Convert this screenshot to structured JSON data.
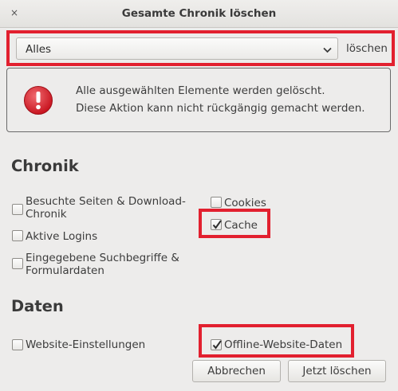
{
  "window": {
    "title": "Gesamte Chronik löschen",
    "close_glyph": "×"
  },
  "range": {
    "selected": "Alles",
    "suffix_label": "löschen"
  },
  "warning": {
    "icon": "warning-icon",
    "line1": "Alle ausgewählten Elemente werden gelöscht.",
    "line2": "Diese Aktion kann nicht rückgängig gemacht werden."
  },
  "sections": {
    "history_title": "Chronik",
    "data_title": "Daten"
  },
  "history_items": {
    "visited_line1": "Besuchte Seiten & Download-",
    "visited_line2": "Chronik",
    "visited_checked": false,
    "logins": "Aktive Logins",
    "logins_checked": false,
    "search_line1": "Eingegebene Suchbegriffe &",
    "search_line2": "Formulardaten",
    "search_checked": false,
    "cookies": "Cookies",
    "cookies_checked": false,
    "cache": "Cache",
    "cache_checked": true
  },
  "data_items": {
    "site_settings": "Website-Einstellungen",
    "site_settings_checked": false,
    "offline_data": "Offline-Website-Daten",
    "offline_data_checked": true
  },
  "buttons": {
    "cancel": "Abbrechen",
    "clear_now": "Jetzt löschen"
  },
  "colors": {
    "highlight": "#e2202f",
    "warning_icon": "#d81f2a"
  }
}
